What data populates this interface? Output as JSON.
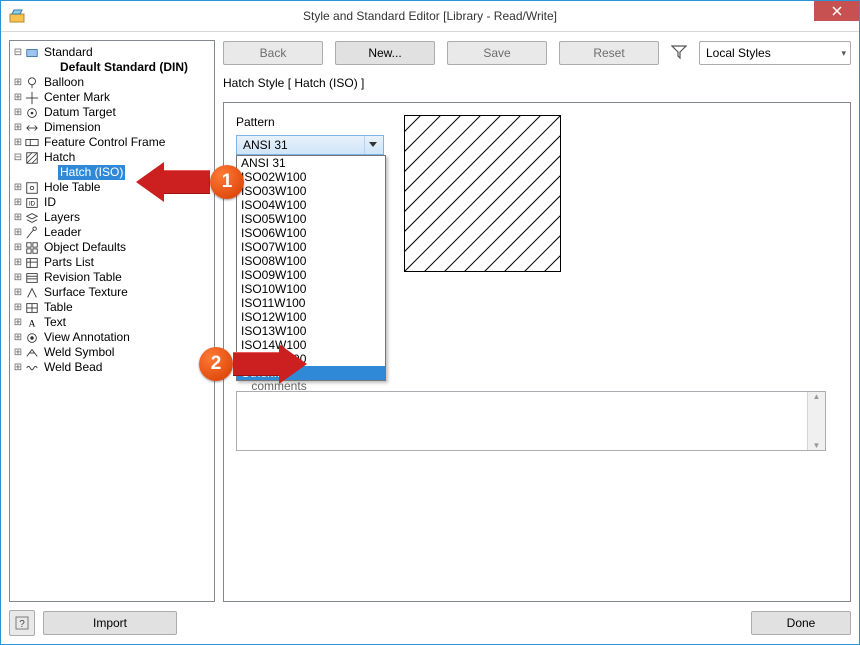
{
  "window": {
    "title": "Style and Standard Editor [Library - Read/Write]"
  },
  "toolbar": {
    "back": "Back",
    "new": "New...",
    "save": "Save",
    "reset": "Reset",
    "scope_selected": "Local Styles"
  },
  "tree": {
    "items": [
      {
        "label": "Standard",
        "icon": "std",
        "depth": 0,
        "tw": "minus"
      },
      {
        "label": "Default Standard (DIN)",
        "icon": "",
        "depth": 1,
        "bold": true
      },
      {
        "label": "Balloon",
        "icon": "balloon",
        "depth": 0,
        "tw": "plus"
      },
      {
        "label": "Center Mark",
        "icon": "center",
        "depth": 0,
        "tw": "plus"
      },
      {
        "label": "Datum Target",
        "icon": "datum",
        "depth": 0,
        "tw": "plus"
      },
      {
        "label": "Dimension",
        "icon": "dim",
        "depth": 0,
        "tw": "plus"
      },
      {
        "label": "Feature Control Frame",
        "icon": "fcf",
        "depth": 0,
        "tw": "plus"
      },
      {
        "label": "Hatch",
        "icon": "hatch",
        "depth": 0,
        "tw": "minus"
      },
      {
        "label": "Hatch (ISO)",
        "icon": "",
        "depth": 1,
        "selected": true
      },
      {
        "label": "Hole Table",
        "icon": "hole",
        "depth": 0,
        "tw": "plus"
      },
      {
        "label": "ID",
        "icon": "id",
        "depth": 0,
        "tw": "plus"
      },
      {
        "label": "Layers",
        "icon": "layers",
        "depth": 0,
        "tw": "plus"
      },
      {
        "label": "Leader",
        "icon": "leader",
        "depth": 0,
        "tw": "plus"
      },
      {
        "label": "Object Defaults",
        "icon": "obj",
        "depth": 0,
        "tw": "plus"
      },
      {
        "label": "Parts List",
        "icon": "parts",
        "depth": 0,
        "tw": "plus"
      },
      {
        "label": "Revision Table",
        "icon": "rev",
        "depth": 0,
        "tw": "plus"
      },
      {
        "label": "Surface Texture",
        "icon": "surf",
        "depth": 0,
        "tw": "plus"
      },
      {
        "label": "Table",
        "icon": "table",
        "depth": 0,
        "tw": "plus"
      },
      {
        "label": "Text",
        "icon": "text",
        "depth": 0,
        "tw": "plus"
      },
      {
        "label": "View Annotation",
        "icon": "view",
        "depth": 0,
        "tw": "plus"
      },
      {
        "label": "Weld Symbol",
        "icon": "wsym",
        "depth": 0,
        "tw": "plus"
      },
      {
        "label": "Weld Bead",
        "icon": "wbead",
        "depth": 0,
        "tw": "plus"
      }
    ]
  },
  "style_header": "Hatch Style [ Hatch (ISO) ]",
  "pattern_label": "Pattern",
  "pattern_selected": "ANSI 31",
  "pattern_options": [
    "ANSI 31",
    "ISO02W100",
    "ISO03W100",
    "ISO04W100",
    "ISO05W100",
    "ISO06W100",
    "ISO07W100",
    "ISO08W100",
    "ISO09W100",
    "ISO10W100",
    "ISO11W100",
    "ISO12W100",
    "ISO13W100",
    "ISO14W100",
    "ISO15W100",
    "Other..."
  ],
  "pattern_highlight": "Other...",
  "comments_label_partial": "comments",
  "bottom": {
    "import": "Import",
    "done": "Done",
    "help": "?"
  },
  "callouts": {
    "one": "1",
    "two": "2"
  }
}
